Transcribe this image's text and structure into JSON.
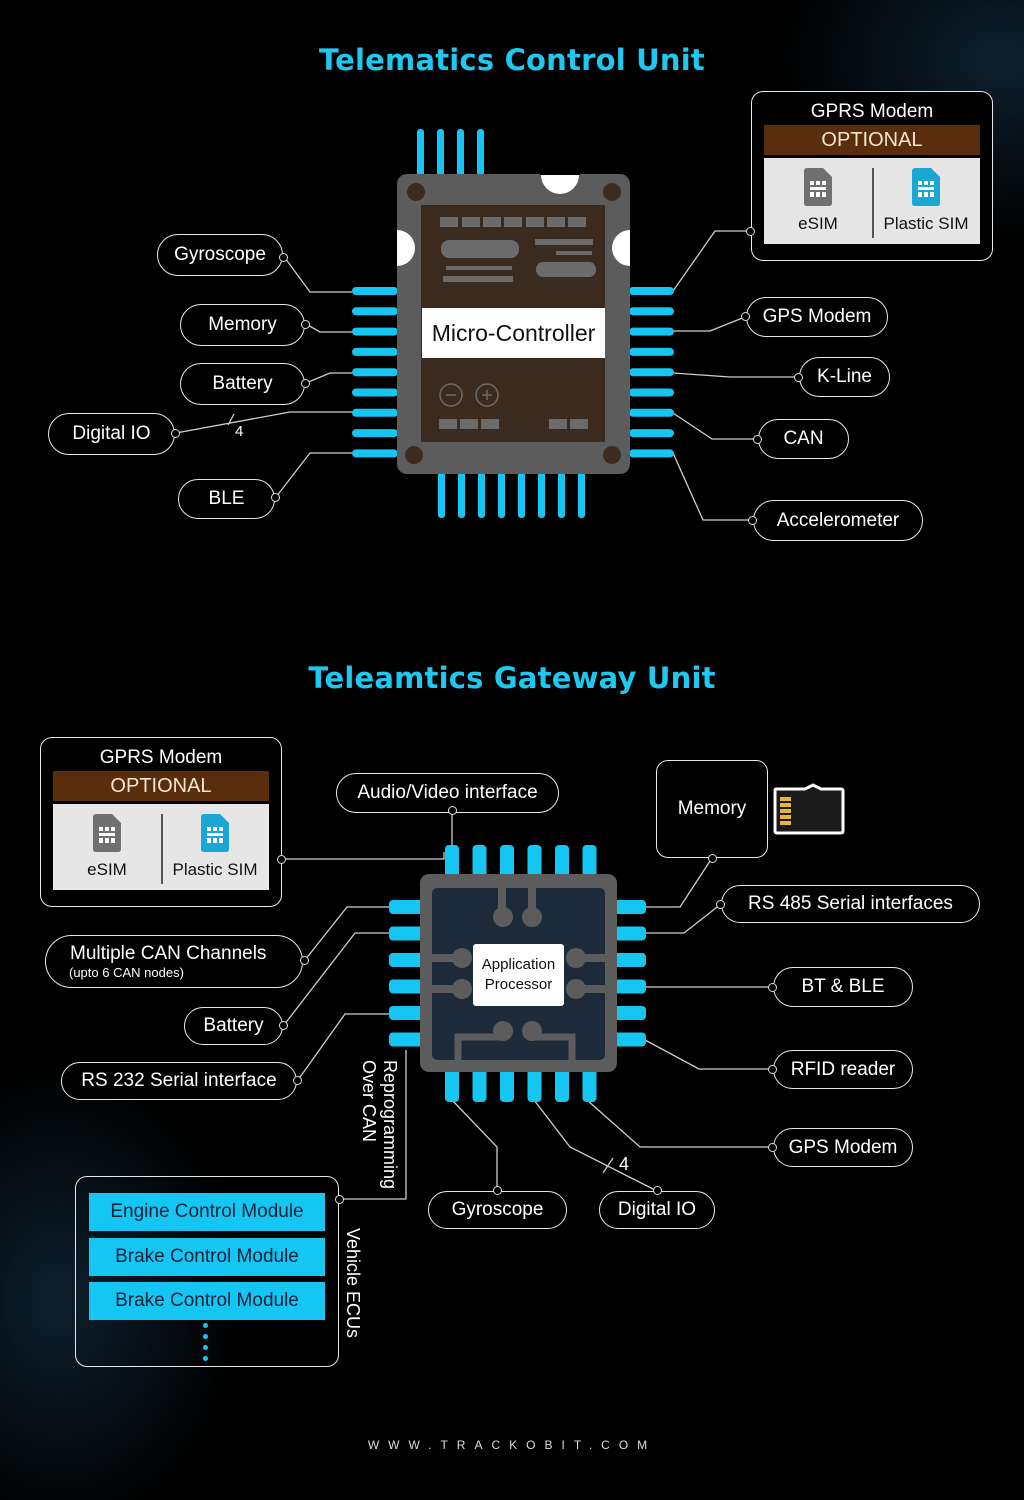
{
  "tcu": {
    "title": "Telematics Control Unit",
    "chip_label": "Micro-Controller",
    "left_labels": [
      "Gyroscope",
      "Memory",
      "Battery",
      "Digital IO",
      "BLE"
    ],
    "right_labels": [
      "GPS Modem",
      "K-Line",
      "CAN",
      "Accelerometer"
    ],
    "digital_io_bus_width": "4",
    "modem": {
      "title": "GPRS Modem",
      "badge": "OPTIONAL",
      "options": [
        {
          "label": "eSIM",
          "icon": "sim-card-icon",
          "color": "#707070"
        },
        {
          "label": "Plastic SIM",
          "icon": "sim-card-icon",
          "color": "#1aa7d6"
        }
      ]
    }
  },
  "tgu": {
    "title": "Teleamtics Gateway Unit",
    "chip_label_line1": "Application",
    "chip_label_line2": "Processor",
    "top_label": "Audio/Video interface",
    "memory_label": "Memory",
    "memory_icon": "micro-sd-card-icon",
    "left_labels": {
      "can_channels": "Multiple CAN Channels",
      "can_channels_note": "(upto 6 CAN nodes)",
      "battery": "Battery",
      "rs232": "RS 232 Serial interface"
    },
    "right_labels": [
      "RS 485 Serial interfaces",
      "BT & BLE",
      "RFID reader",
      "GPS Modem"
    ],
    "bottom_labels": [
      "Gyroscope",
      "Digital IO"
    ],
    "digital_io_bus_width": "4",
    "reprogramming_label_line1": "Reprogramming",
    "reprogramming_label_line2": "Over CAN",
    "vehicle_ecus_label": "Vehicle ECUs",
    "ecus": [
      "Engine Control Module",
      "Brake Control Module",
      "Brake Control Module"
    ],
    "modem": {
      "title": "GPRS Modem",
      "badge": "OPTIONAL",
      "options": [
        {
          "label": "eSIM",
          "icon": "sim-card-icon",
          "color": "#707070"
        },
        {
          "label": "Plastic SIM",
          "icon": "sim-card-icon",
          "color": "#1aa7d6"
        }
      ]
    }
  },
  "footer": "WWW.TRACKOBIT.COM",
  "colors": {
    "accent": "#1ec8f0",
    "pin": "#15c6f2",
    "chip_body": "#5b5b5b",
    "chip_inner": "#3d2b1f",
    "optional_bg": "#5a2e0c"
  }
}
